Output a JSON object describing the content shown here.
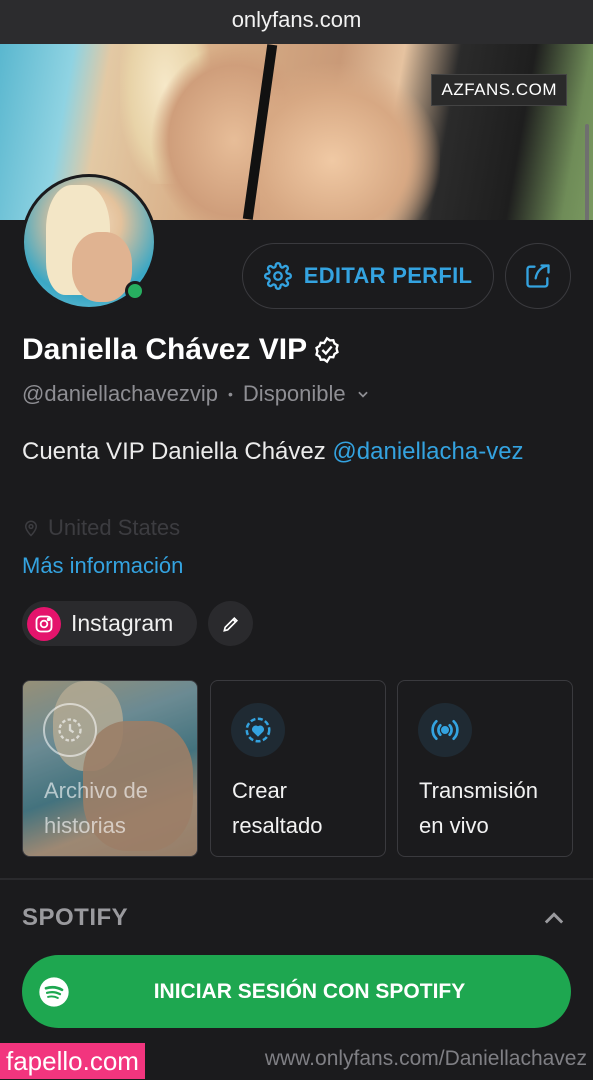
{
  "browser": {
    "url": "onlyfans.com"
  },
  "watermarks": {
    "top": "AZFANS.COM",
    "bottom_left": "fapello.com",
    "bottom_right": "www.onlyfans.com/Daniellachavez"
  },
  "profile": {
    "name": "Daniella Chávez VIP",
    "handle": "@daniellachavezvip",
    "status": "Disponible",
    "bio_text": "Cuenta VIP Daniella Chávez ",
    "bio_mention": "@daniellacha-vez",
    "location": "United States",
    "more_info": "Más información"
  },
  "actions": {
    "edit_profile": "EDITAR PERFIL"
  },
  "socials": {
    "instagram": "Instagram"
  },
  "highlights": [
    {
      "label": "Archivo de historias"
    },
    {
      "label": "Crear resaltado"
    },
    {
      "label": "Transmisión en vivo"
    }
  ],
  "spotify": {
    "title": "SPOTIFY",
    "button": "INICIAR SESIÓN CON SPOTIFY"
  },
  "colors": {
    "accent": "#34a3e0",
    "online": "#27ae60",
    "spotify": "#1ea750",
    "background": "#1b1b1d"
  },
  "icons": [
    "gear-icon",
    "share-icon",
    "verified-icon",
    "chevron-down-icon",
    "location-pin-icon",
    "instagram-icon",
    "pencil-icon",
    "clock-icon",
    "heart-circle-icon",
    "broadcast-icon",
    "chevron-up-icon",
    "spotify-icon"
  ]
}
